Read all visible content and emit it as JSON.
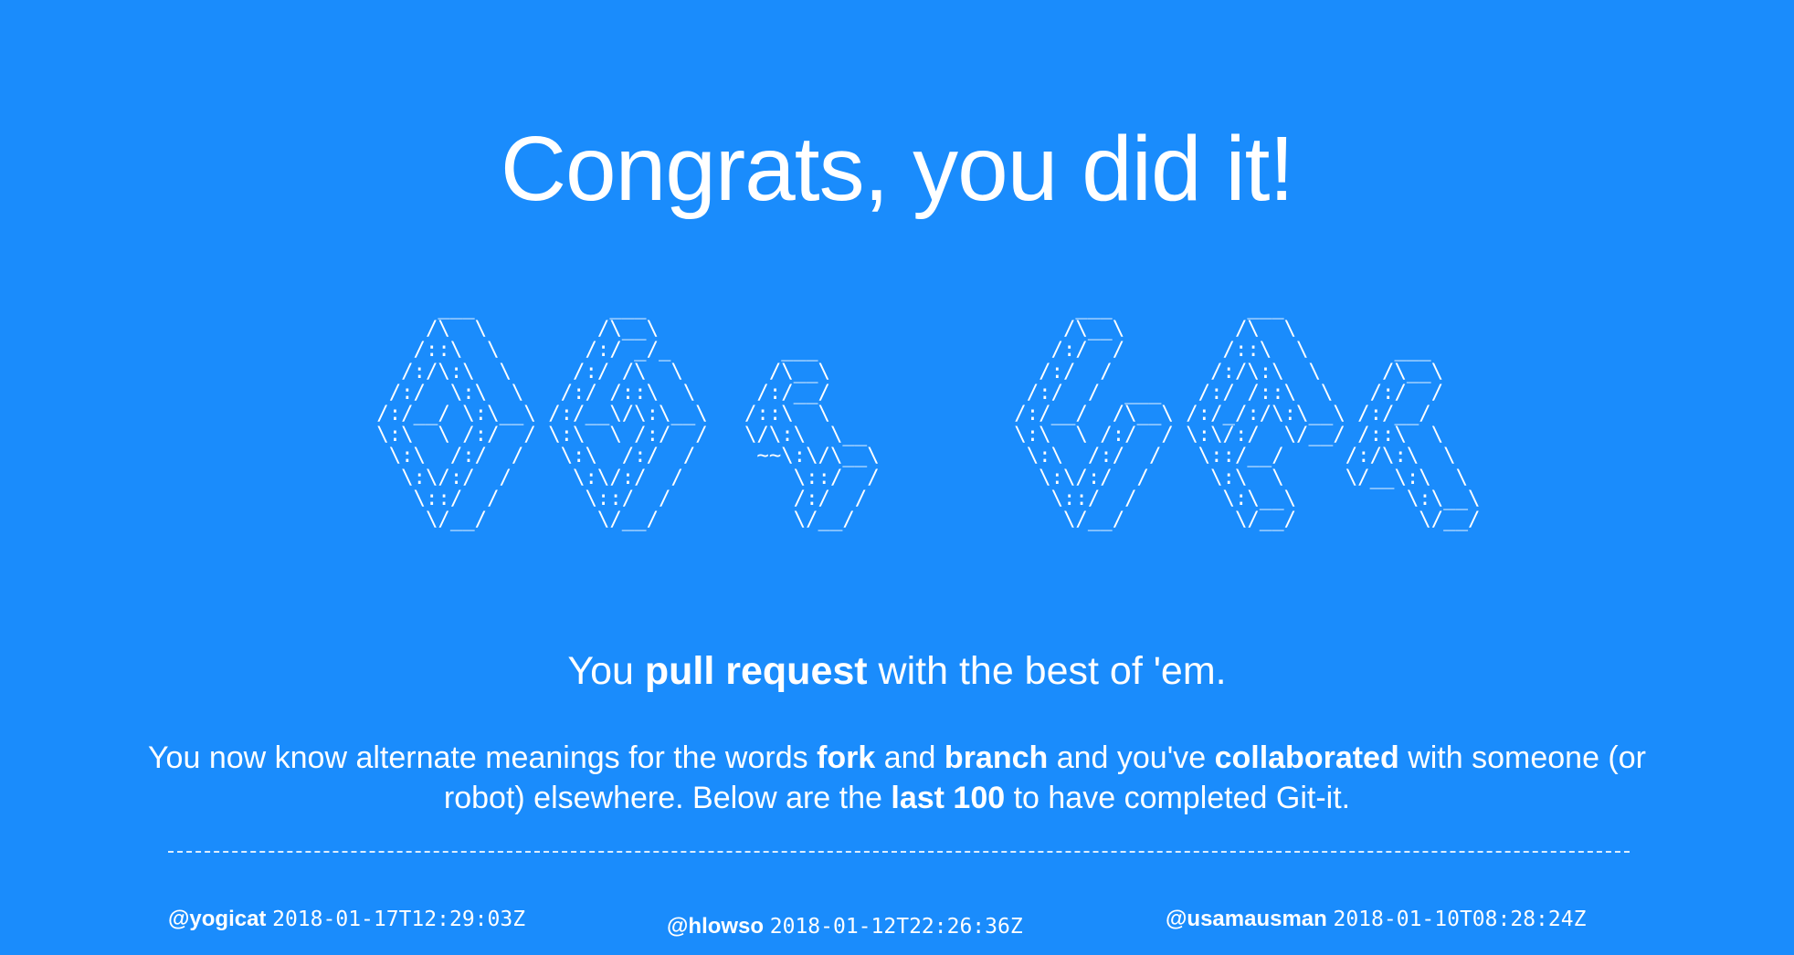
{
  "headline": "Congrats, you did it!",
  "ascii_art": "        ___           ___                                   ___           ___                \n       /\\  \\         /\\__\\                                 /\\__\\         /\\  \\               \n      /::\\  \\       /:/ _/_         ___                   /:/  /        /::\\  \\       ___    \n     /:/\\:\\  \\     /:/ /\\  \\       /\\__\\                 /:/  /        /:/\\:\\  \\     /\\__\\   \n    /:/  \\:\\  \\   /:/ /::\\  \\     /:/__/                /:/  /  ___   /:/ /::\\  \\   /:/  /   \n   /:/__/ \\:\\__\\ /:/__\\/\\:\\__\\   /::\\  \\               /:/__/  /\\__\\ /:/_/:/\\:\\__\\ /:/__/    \n   \\:\\  \\ /:/  / \\:\\  \\ /:/  /   \\/\\:\\  \\__            \\:\\  \\ /:/  / \\:\\/:/  \\/__/ /::\\  \\   \n    \\:\\  /:/  /   \\:\\  /:/  /     ~~\\:\\/\\__\\            \\:\\  /:/  /   \\::/__/     /:/\\:\\  \\  \n     \\:\\/:/  /     \\:\\/:/  /         \\::/  /             \\:\\/:/  /     \\:\\  \\     \\/__\\:\\  \\ \n      \\::/  /       \\::/  /          /:/  /               \\::/  /       \\:\\__\\         \\:\\__\\\n       \\/__/         \\/__/           \\/__/                 \\/__/         \\/__/          \\/__/",
  "tagline": {
    "prefix": "You ",
    "bold": "pull request",
    "suffix": " with the best of 'em."
  },
  "paragraph": {
    "t1": "You now know alternate meanings for the words ",
    "b1": "fork",
    "t2": " and ",
    "b2": "branch",
    "t3": " and you've ",
    "b3": "collaborated",
    "t4": " with someone (or robot) elsewhere. Below are the ",
    "b4": "last 100",
    "t5": " to have completed Git-it."
  },
  "completions": [
    {
      "user": "@yogicat",
      "time": "2018-01-17T12:29:03Z"
    },
    {
      "user": "@hlowso",
      "time": "2018-01-12T22:26:36Z"
    },
    {
      "user": "@usamausman",
      "time": "2018-01-10T08:28:24Z"
    }
  ]
}
